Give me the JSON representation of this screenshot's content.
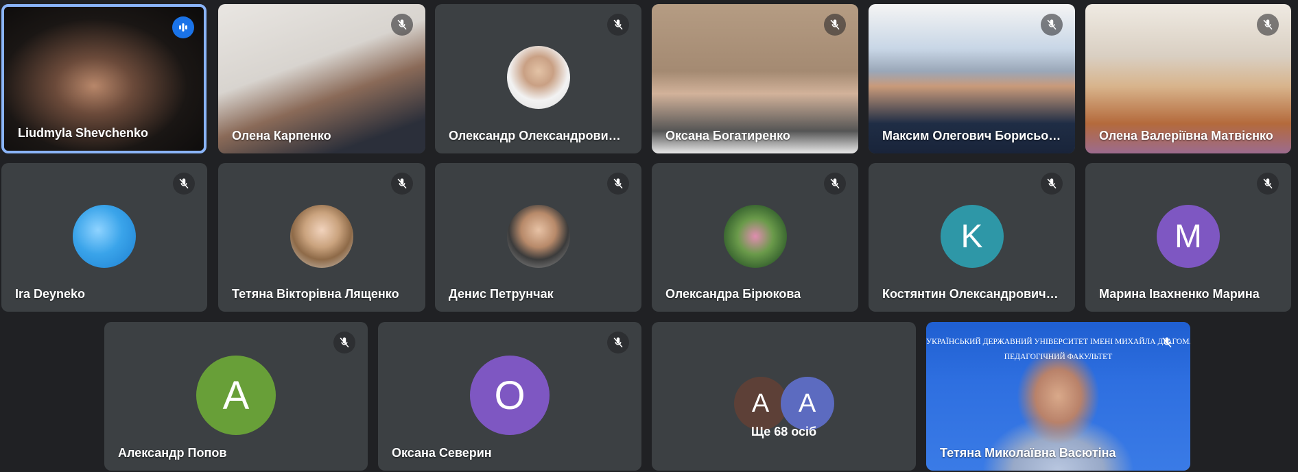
{
  "participants_row1": [
    {
      "name": "Liudmyla Shevchenko",
      "state": "speaking",
      "icon": "speaking-indicator-icon"
    },
    {
      "name": "Олена Карпенко",
      "state": "muted",
      "icon": "mic-off-icon"
    },
    {
      "name": "Олександр Олександрович ...",
      "state": "muted",
      "icon": "mic-off-icon"
    },
    {
      "name": "Оксана Богатиренко",
      "state": "muted",
      "icon": "mic-off-icon"
    },
    {
      "name": "Максим Олегович Борисьон...",
      "state": "muted",
      "icon": "mic-off-icon"
    },
    {
      "name": "Олена Валеріївна Матвієнко",
      "state": "muted",
      "icon": "mic-off-icon"
    }
  ],
  "participants_row2": [
    {
      "name": "Ira Deyneko",
      "state": "muted",
      "icon": "mic-off-icon"
    },
    {
      "name": "Тетяна Вікторівна Лященко",
      "state": "muted",
      "icon": "mic-off-icon"
    },
    {
      "name": "Денис Петрунчак",
      "state": "muted",
      "icon": "mic-off-icon"
    },
    {
      "name": "Олександра Бірюкова",
      "state": "muted",
      "icon": "mic-off-icon"
    },
    {
      "name": "Костянтин Олександрович З...",
      "state": "muted",
      "icon": "mic-off-icon",
      "initial": "K",
      "avatar_color": "#2e97a7"
    },
    {
      "name": "Марина Івахненко Марина",
      "state": "muted",
      "icon": "mic-off-icon",
      "initial": "M",
      "avatar_color": "#7e57c2"
    }
  ],
  "participants_row3": [
    {
      "name": "Александр Попов",
      "state": "muted",
      "icon": "mic-off-icon",
      "initial": "A",
      "avatar_color": "#689f38"
    },
    {
      "name": "Оксана Северин",
      "state": "muted",
      "icon": "mic-off-icon",
      "initial": "O",
      "avatar_color": "#7e57c2"
    },
    {
      "name": "Тетяна Миколаївна Васютіна",
      "state": "muted",
      "icon": "mic-off-icon"
    }
  ],
  "others_tile": {
    "label": "Ще 68 осіб",
    "avatars": [
      {
        "initial": "A",
        "color": "#5d4037"
      },
      {
        "initial": "A",
        "color": "#5c6bc0"
      }
    ]
  },
  "banner": {
    "line1": "УКРАЇНСЬКИЙ ДЕРЖАВНИЙ УНІВЕРСИТЕТ ІМЕНІ МИХАЙЛА ДРАГОМАНОВА",
    "line2": "ПЕДАГОГІЧНИЙ ФАКУЛЬТЕТ"
  },
  "colors": {
    "page_bg": "#202124",
    "tile_bg": "#3c4043",
    "active_border": "#8ab4f8",
    "speaking_badge": "#1a73e8"
  }
}
